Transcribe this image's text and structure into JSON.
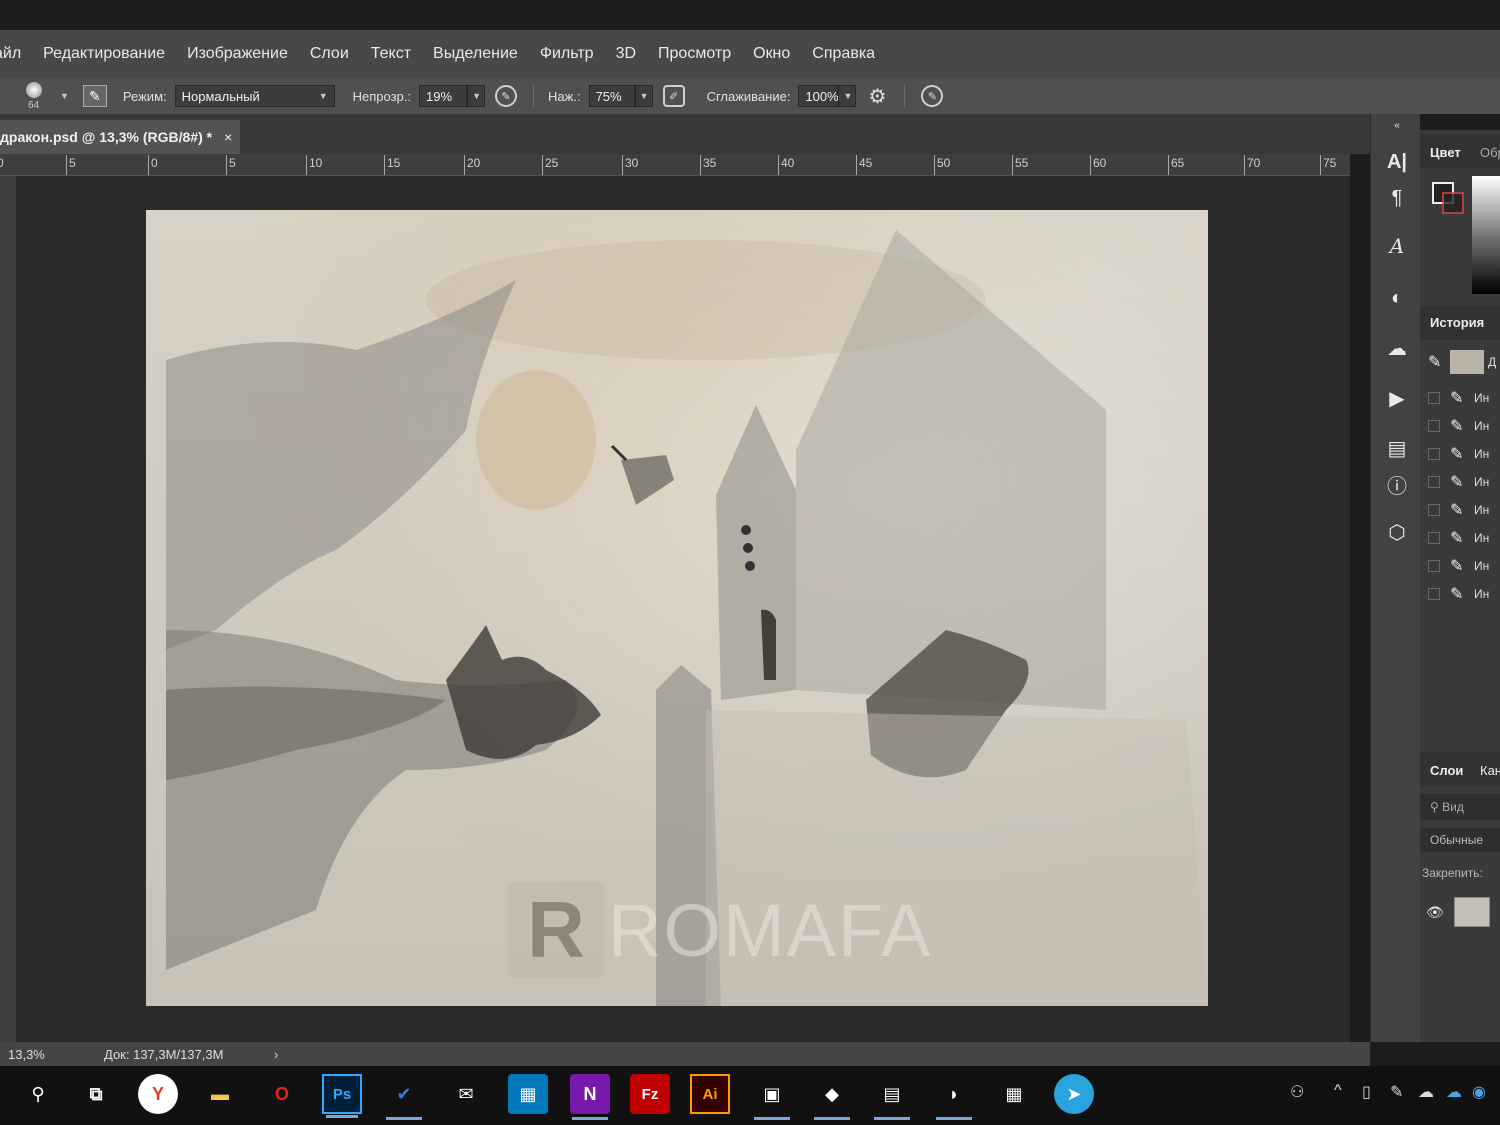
{
  "menu": [
    "айл",
    "Редактирование",
    "Изображение",
    "Слои",
    "Текст",
    "Выделение",
    "Фильтр",
    "3D",
    "Просмотр",
    "Окно",
    "Справка"
  ],
  "options": {
    "brush_size": "64",
    "mode_label": "Режим:",
    "mode_value": "Нормальный",
    "opacity_label": "Непрозр.:",
    "opacity_value": "19%",
    "pressure_label": "Наж.:",
    "pressure_value": "75%",
    "smoothing_label": "Сглаживание:",
    "smoothing_value": "100%"
  },
  "document_tab": {
    "title": "дракон.psd @ 13,3% (RGB/8#) *",
    "close": "×"
  },
  "ruler_ticks": [
    "0",
    "5",
    "0",
    "5",
    "10",
    "15",
    "20",
    "25",
    "30",
    "35",
    "40",
    "45",
    "50",
    "55",
    "60",
    "65",
    "70",
    "75"
  ],
  "watermark": {
    "letter": "R",
    "text": "ROMAFA"
  },
  "status": {
    "zoom": "13,3%",
    "doc": "Док: 137,3M/137,3M",
    "arrow": "›"
  },
  "panels": {
    "color_tab": "Цвет",
    "swatches_tab": "Обр",
    "history_tab": "История",
    "history_first": "Д",
    "history_items": [
      "Ин",
      "Ин",
      "Ин",
      "Ин",
      "Ин",
      "Ин",
      "Ин",
      "Ин"
    ],
    "layers_tab": "Слои",
    "channels_tab": "Кан",
    "search_placeholder": "Вид",
    "blend_mode": "Обычные",
    "lock_label": "Закрепить:"
  },
  "taskbar_apps": [
    {
      "name": "search",
      "glyph": "⚲"
    },
    {
      "name": "task-view",
      "glyph": "⧉"
    },
    {
      "name": "yandex-browser",
      "glyph": "Y"
    },
    {
      "name": "file-explorer",
      "glyph": "▬"
    },
    {
      "name": "opera",
      "glyph": "O"
    },
    {
      "name": "photoshop",
      "glyph": "Ps"
    },
    {
      "name": "todo",
      "glyph": "✔"
    },
    {
      "name": "mail",
      "glyph": "✉"
    },
    {
      "name": "trello",
      "glyph": "▦"
    },
    {
      "name": "onenote",
      "glyph": "N"
    },
    {
      "name": "filezilla",
      "glyph": "Fz"
    },
    {
      "name": "illustrator",
      "glyph": "Ai"
    },
    {
      "name": "app-13",
      "glyph": "▣"
    },
    {
      "name": "app-14",
      "glyph": "◆"
    },
    {
      "name": "app-15",
      "glyph": "▤"
    },
    {
      "name": "app-16",
      "glyph": "◗"
    },
    {
      "name": "calculator",
      "glyph": "▦"
    },
    {
      "name": "telegram",
      "glyph": "➤"
    }
  ],
  "colors": {
    "yandex": "#e53935",
    "opera": "#e0261b",
    "photoshop": "#31a8ff",
    "photoshop_bg": "#001e36",
    "todo": "#2f7de1",
    "trello": "#0079bf",
    "onenote": "#7719aa",
    "filezilla": "#bf0000",
    "illustrator": "#ff9a00",
    "telegram": "#2aa3df"
  }
}
